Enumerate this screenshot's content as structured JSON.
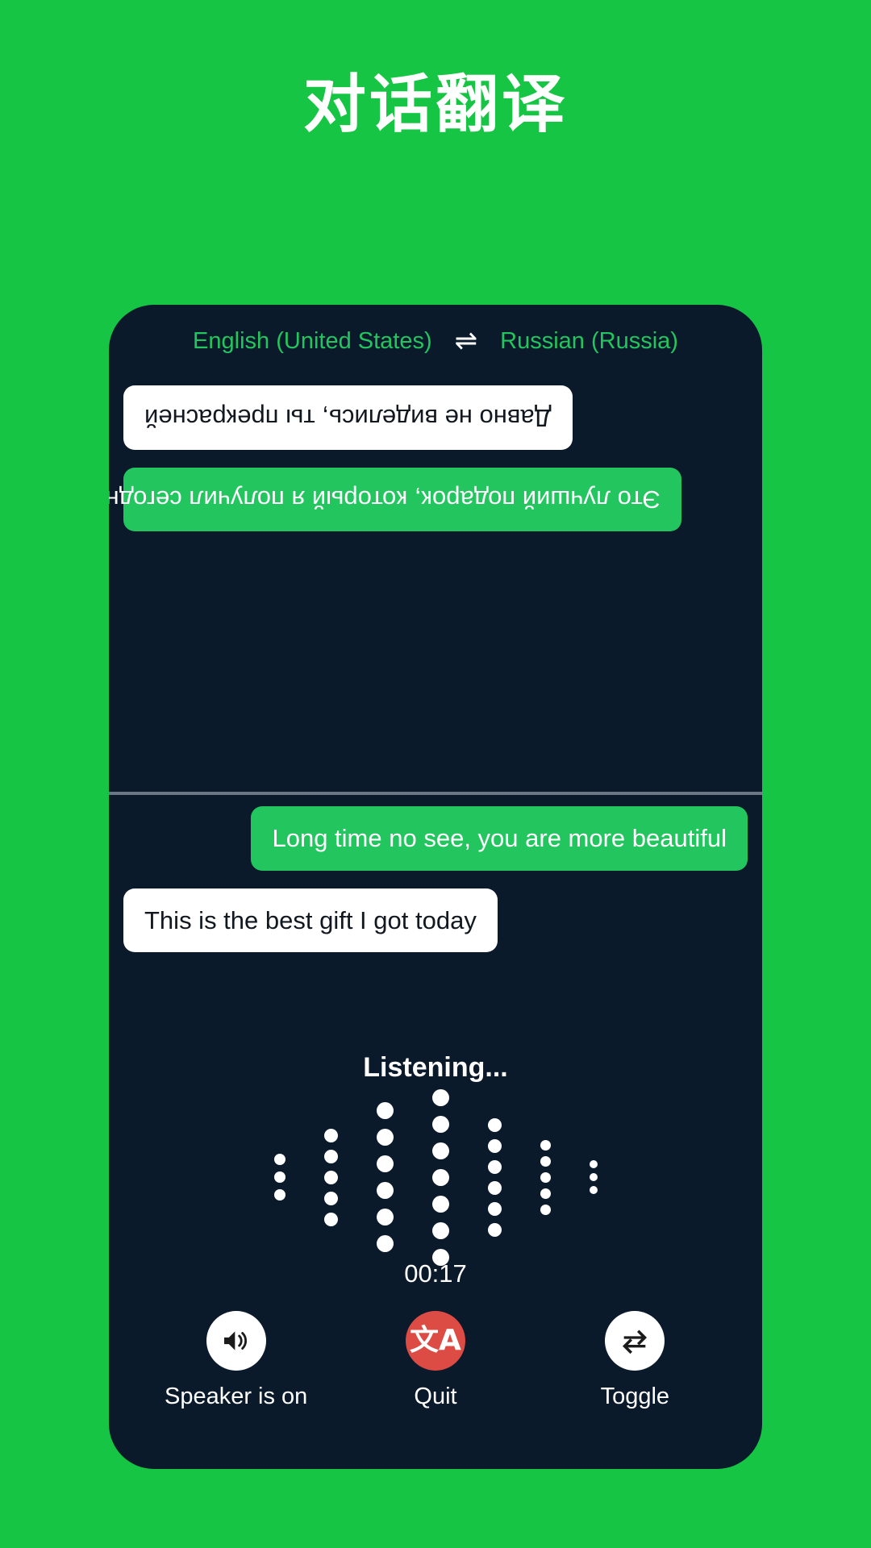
{
  "page": {
    "title": "对话翻译",
    "background_color": "#16c543",
    "card_color": "#0a1a2b",
    "accent_green": "#22c55e",
    "quit_red": "#dc4b44"
  },
  "language_bar": {
    "source_language": "English (United States)",
    "target_language": "Russian (Russia)",
    "swap_icon": "⇌"
  },
  "conversation": {
    "translated_panel": {
      "orientation": "flipped-180",
      "messages": [
        {
          "text": "Это лучший подарок, который я получил сегодня",
          "style": "green",
          "align": "right"
        },
        {
          "text": "Давно не виделись, ты прекрасней",
          "style": "white",
          "align": "right"
        }
      ]
    },
    "source_panel": {
      "orientation": "normal",
      "messages": [
        {
          "text": "Long time no see, you are more beautiful",
          "style": "green",
          "align": "right"
        },
        {
          "text": "This is the best gift I got today",
          "style": "white",
          "align": "left"
        }
      ]
    }
  },
  "recording": {
    "status_label": "Listening...",
    "timer": "00:17",
    "waveform": {
      "columns": [
        {
          "dots": 3,
          "size": 14
        },
        {
          "dots": 5,
          "size": 17
        },
        {
          "dots": 6,
          "size": 21
        },
        {
          "dots": 7,
          "size": 21
        },
        {
          "dots": 6,
          "size": 17
        },
        {
          "dots": 5,
          "size": 13
        },
        {
          "dots": 3,
          "size": 10
        }
      ]
    }
  },
  "actions": [
    {
      "label": "Speaker is on",
      "icon": "speaker-on-icon",
      "circle_style": "white"
    },
    {
      "label": "Quit",
      "icon": "translate-icon",
      "circle_style": "red",
      "glyph": "文A"
    },
    {
      "label": "Toggle",
      "icon": "repeat-swap-icon",
      "circle_style": "white"
    }
  ]
}
